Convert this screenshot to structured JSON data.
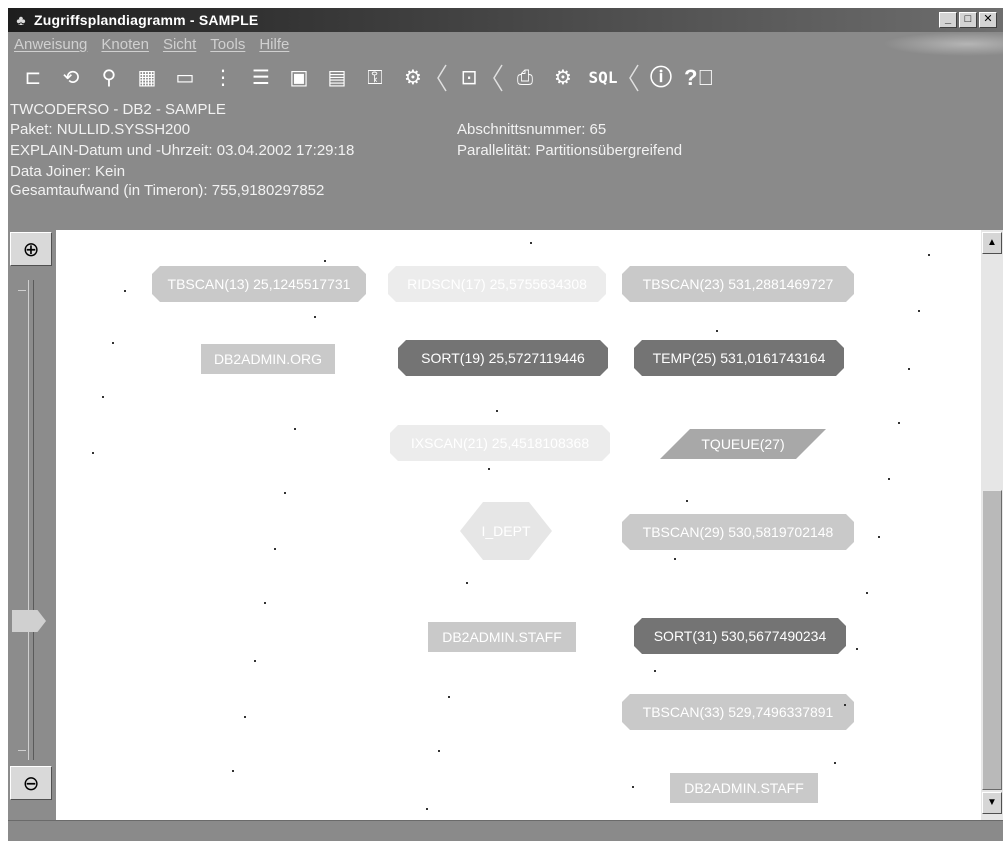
{
  "window": {
    "title": "Zugriffsplandiagramm - SAMPLE",
    "buttons": {
      "minimize": "_",
      "maximize": "□",
      "close": "✕"
    }
  },
  "menu": [
    "Anweisung",
    "Knoten",
    "Sicht",
    "Tools",
    "Hilfe"
  ],
  "toolbar": {
    "icons": [
      "tree-layout-icon",
      "refresh-icon",
      "find-node-icon",
      "statistics-icon",
      "command-icon",
      "hierarchy-icon",
      "list-icon",
      "monitor-icon",
      "document-icon",
      "key-icon",
      "tools-icon",
      "window-icon",
      "print-icon",
      "settings-icon",
      "info-icon",
      "help-icon"
    ],
    "sql_label": "SQL"
  },
  "info": {
    "database": "TWCODERSO - DB2 - SAMPLE",
    "package": "Paket: NULLID.SYSSH200",
    "explain_date": "EXPLAIN-Datum und -Uhrzeit: 03.04.2002 17:29:18",
    "data_joiner": "Data Joiner: Kein",
    "total_cost": "Gesamtaufwand (in Timeron): 755,9180297852",
    "section_number": "Abschnittsnummer: 65",
    "parallelism": "Parallelität: Partitionsübergreifend"
  },
  "nodes": {
    "tbscan13": "TBSCAN(13) 25,1245517731",
    "ridscn17": "RIDSCN(17) 25,5755634308",
    "tbscan23": "TBSCAN(23) 531,2881469727",
    "db2admin_org": "DB2ADMIN.ORG",
    "sort19": "SORT(19) 25,5727119446",
    "temp25": "TEMP(25) 531,0161743164",
    "ixscan21": "IXSCAN(21) 25,4518108368",
    "tqueue27": "TQUEUE(27)",
    "i_dept": "I_DEPT",
    "tbscan29": "TBSCAN(29) 530,5819702148",
    "db2admin_staff_1": "DB2ADMIN.STAFF",
    "sort31": "SORT(31) 530,5677490234",
    "tbscan33": "TBSCAN(33) 529,7496337891",
    "db2admin_staff_2": "DB2ADMIN.STAFF"
  },
  "colors": {
    "window_bg": "#8a8a8a",
    "node_light": "#c9c9c9",
    "node_faint": "#ececec",
    "node_dark": "#747474",
    "node_mid": "#a8a8a8"
  }
}
